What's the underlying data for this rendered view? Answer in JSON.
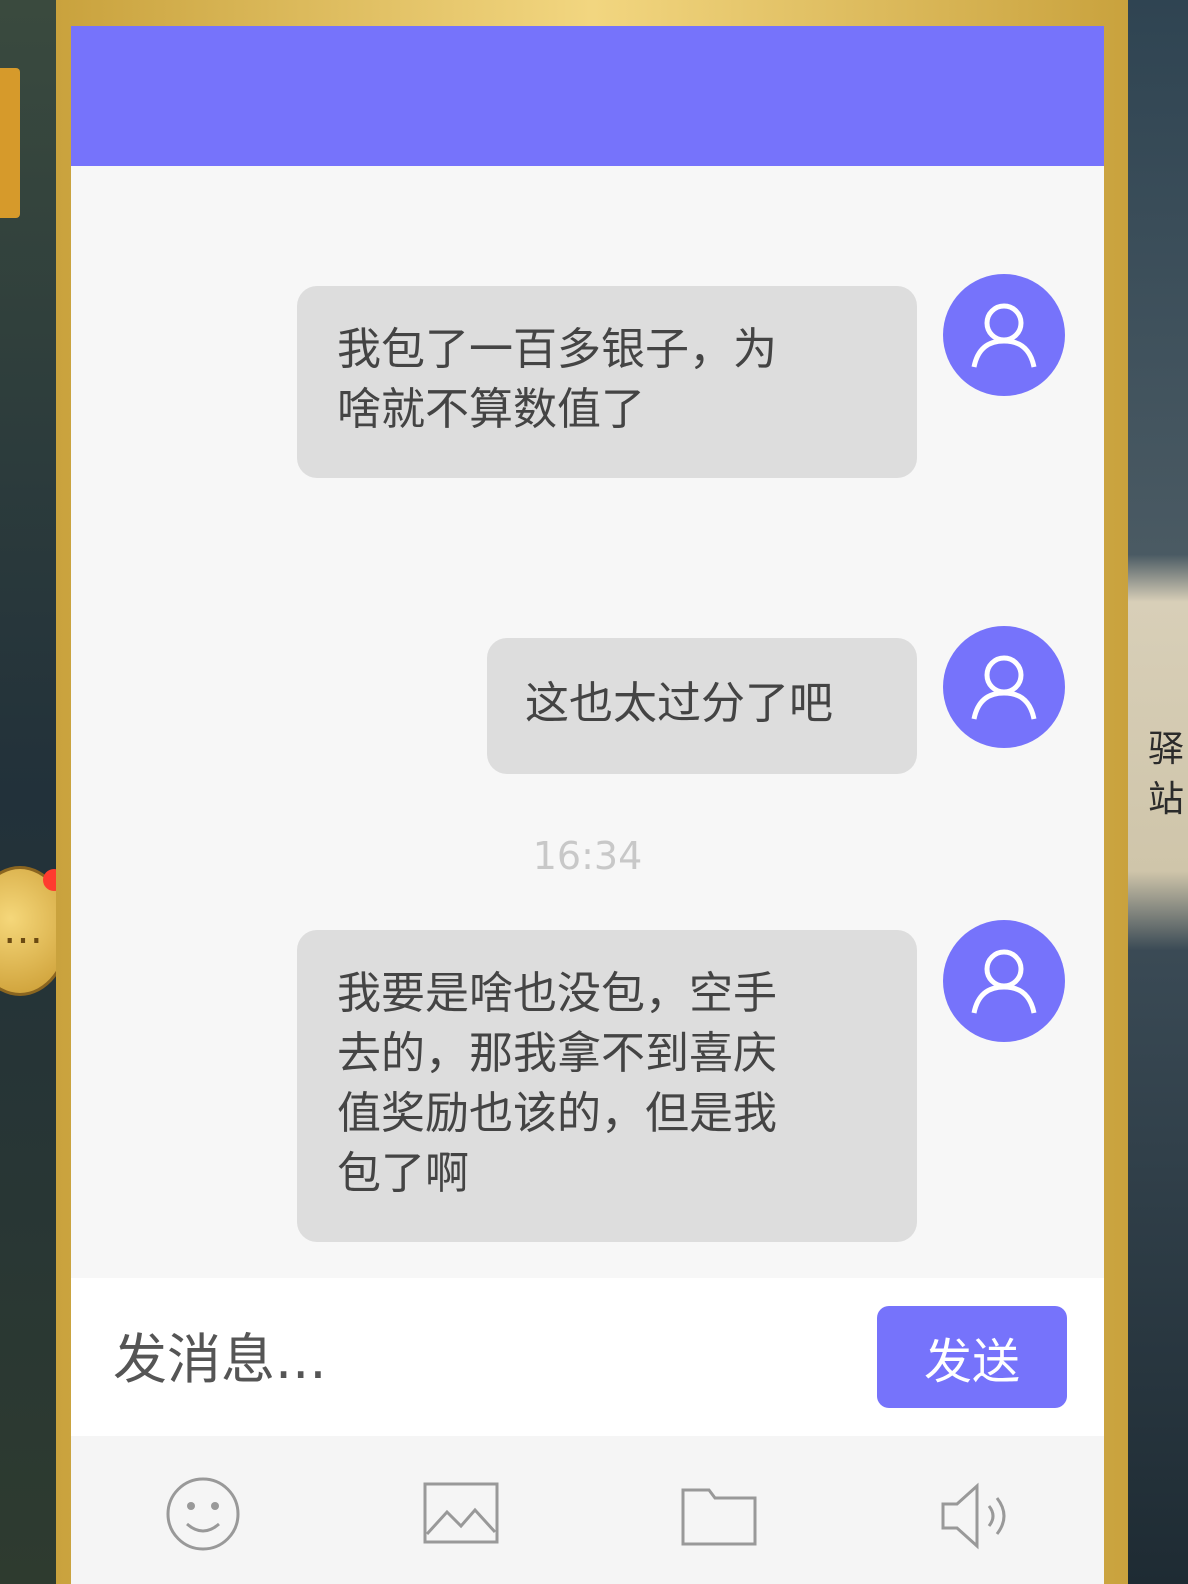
{
  "background": {
    "top_title": "",
    "side_text_1": "驿",
    "side_text_2": "站"
  },
  "chat": {
    "header_color": "#7673fb",
    "messages": [
      {
        "sender": "me",
        "text_lines": [
          "我包了一百多银子，为",
          "啥就不算数值了"
        ]
      },
      {
        "sender": "me",
        "text_lines": [
          "这也太过分了吧"
        ]
      },
      {
        "sender": "me",
        "text_lines": [
          "我要是啥也没包，空手",
          "去的，那我拿不到喜庆",
          "值奖励也该的，但是我",
          "包了啊"
        ]
      }
    ],
    "timestamp": "16:34"
  },
  "input": {
    "placeholder": "发消息...",
    "value": ""
  },
  "send_button": {
    "label": "发送"
  },
  "toolbar": {
    "icons": [
      "emoji-icon",
      "image-icon",
      "folder-icon",
      "voice-icon"
    ]
  }
}
